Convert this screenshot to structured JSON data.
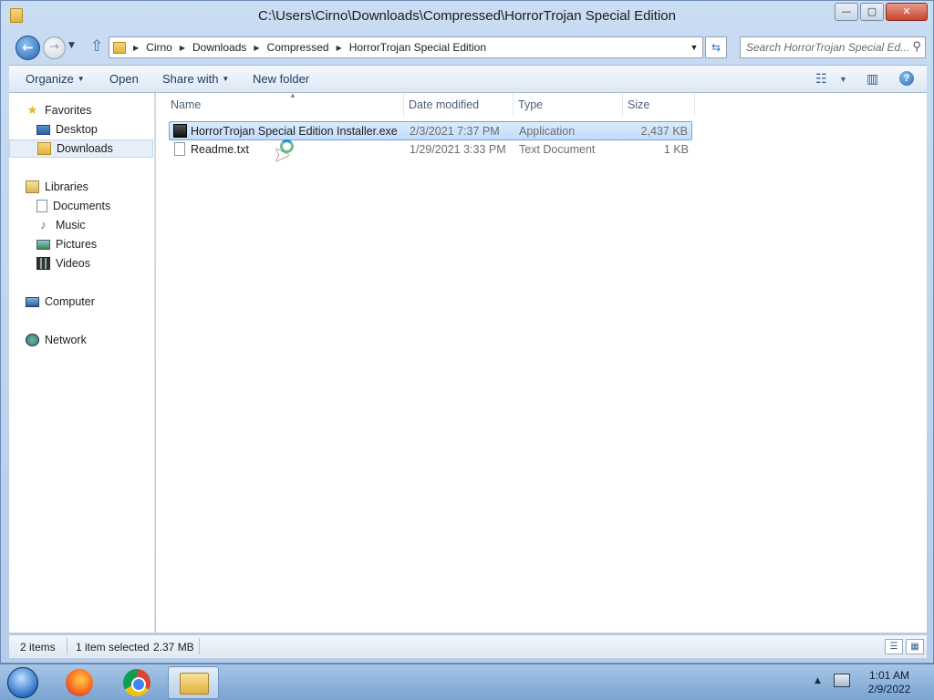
{
  "window": {
    "title": "C:\\Users\\Cirno\\Downloads\\Compressed\\HorrorTrojan Special Edition",
    "controls": {
      "minimize": "—",
      "maximize": "▢",
      "close": "✕"
    }
  },
  "address": {
    "breadcrumbs": [
      "Cirno",
      "Downloads",
      "Compressed",
      "HorrorTrojan Special Edition"
    ],
    "search_placeholder": "Search HorrorTrojan Special Ed..."
  },
  "toolbar": {
    "organize": "Organize",
    "open": "Open",
    "share_with": "Share with",
    "new_folder": "New folder"
  },
  "navpane": {
    "favorites": {
      "label": "Favorites",
      "items": [
        {
          "label": "Desktop"
        },
        {
          "label": "Downloads",
          "selected": true
        }
      ]
    },
    "libraries": {
      "label": "Libraries",
      "items": [
        {
          "label": "Documents"
        },
        {
          "label": "Music"
        },
        {
          "label": "Pictures"
        },
        {
          "label": "Videos"
        }
      ]
    },
    "computer": "Computer",
    "network": "Network"
  },
  "columns": {
    "name": "Name",
    "date": "Date modified",
    "type": "Type",
    "size": "Size"
  },
  "files": [
    {
      "name": "HorrorTrojan Special Edition Installer.exe",
      "date": "2/3/2021 7:37 PM",
      "type": "Application",
      "size": "2,437 KB",
      "selected": true,
      "icon": "exe-icon"
    },
    {
      "name": "Readme.txt",
      "date": "1/29/2021 3:33 PM",
      "type": "Text Document",
      "size": "1 KB",
      "selected": false,
      "icon": "txt-icon"
    }
  ],
  "status": {
    "items": "2 items",
    "selected": "1 item selected",
    "size": "2.37 MB"
  },
  "taskbar": {
    "time": "1:01 AM",
    "date": "2/9/2022"
  }
}
